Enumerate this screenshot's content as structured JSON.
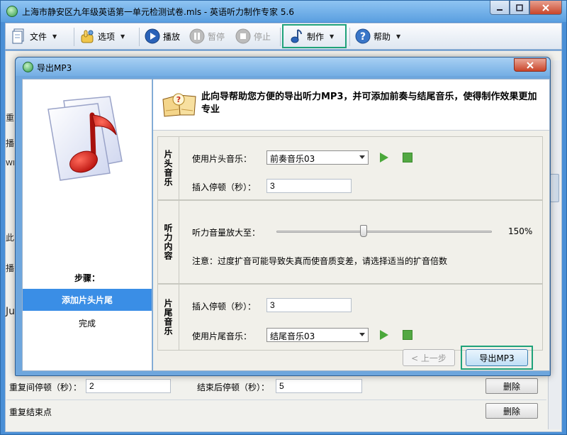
{
  "main_window": {
    "title": "上海市静安区九年级英语第一单元检测试卷.mls - 英语听力制作专家 5.6",
    "controls": {
      "minimize": "0",
      "maximize": "1",
      "close": "r"
    }
  },
  "toolbar": {
    "file": "文件",
    "options": "选项",
    "play": "播放",
    "pause": "暂停",
    "stop": "停止",
    "make": "制作",
    "help": "帮助"
  },
  "background": {
    "side_labels": [
      "重",
      "播",
      "WI",
      "此",
      "播",
      "Ju"
    ],
    "repeat_pause_label": "重复间停顿（秒）：",
    "repeat_pause_value": "2",
    "end_pause_label": "结束后停顿（秒）：",
    "end_pause_value": "5",
    "delete_button": "删除",
    "repeat_end_label": "重复结束点",
    "delete_button_2": "删除"
  },
  "dialog": {
    "title": "导出MP3",
    "close": "r",
    "header_text": "此向导帮助您方便的导出听力MP3，并可添加前奏与结尾音乐，使得制作效果更加专业",
    "steps_title": "步骤：",
    "steps": [
      "添加片头片尾",
      "完成"
    ],
    "sections": {
      "intro": {
        "label": "片头音乐",
        "music_label": "使用片头音乐：",
        "music_value": "前奏音乐03",
        "pause_label": "插入停顿（秒）：",
        "pause_value": "3"
      },
      "listening": {
        "label": "听力内容",
        "volume_label": "听力音量放大至：",
        "volume_value": "150%",
        "volume_level_percent": 40,
        "note": "注意：过度扩音可能导致失真而使音质变差，请选择适当的扩音倍数"
      },
      "outro": {
        "label": "片尾音乐",
        "pause_label": "插入停顿（秒）：",
        "pause_value": "3",
        "music_label": "使用片尾音乐：",
        "music_value": "结尾音乐03"
      }
    },
    "buttons": {
      "prev": "< 上一步",
      "export": "导出MP3"
    }
  }
}
